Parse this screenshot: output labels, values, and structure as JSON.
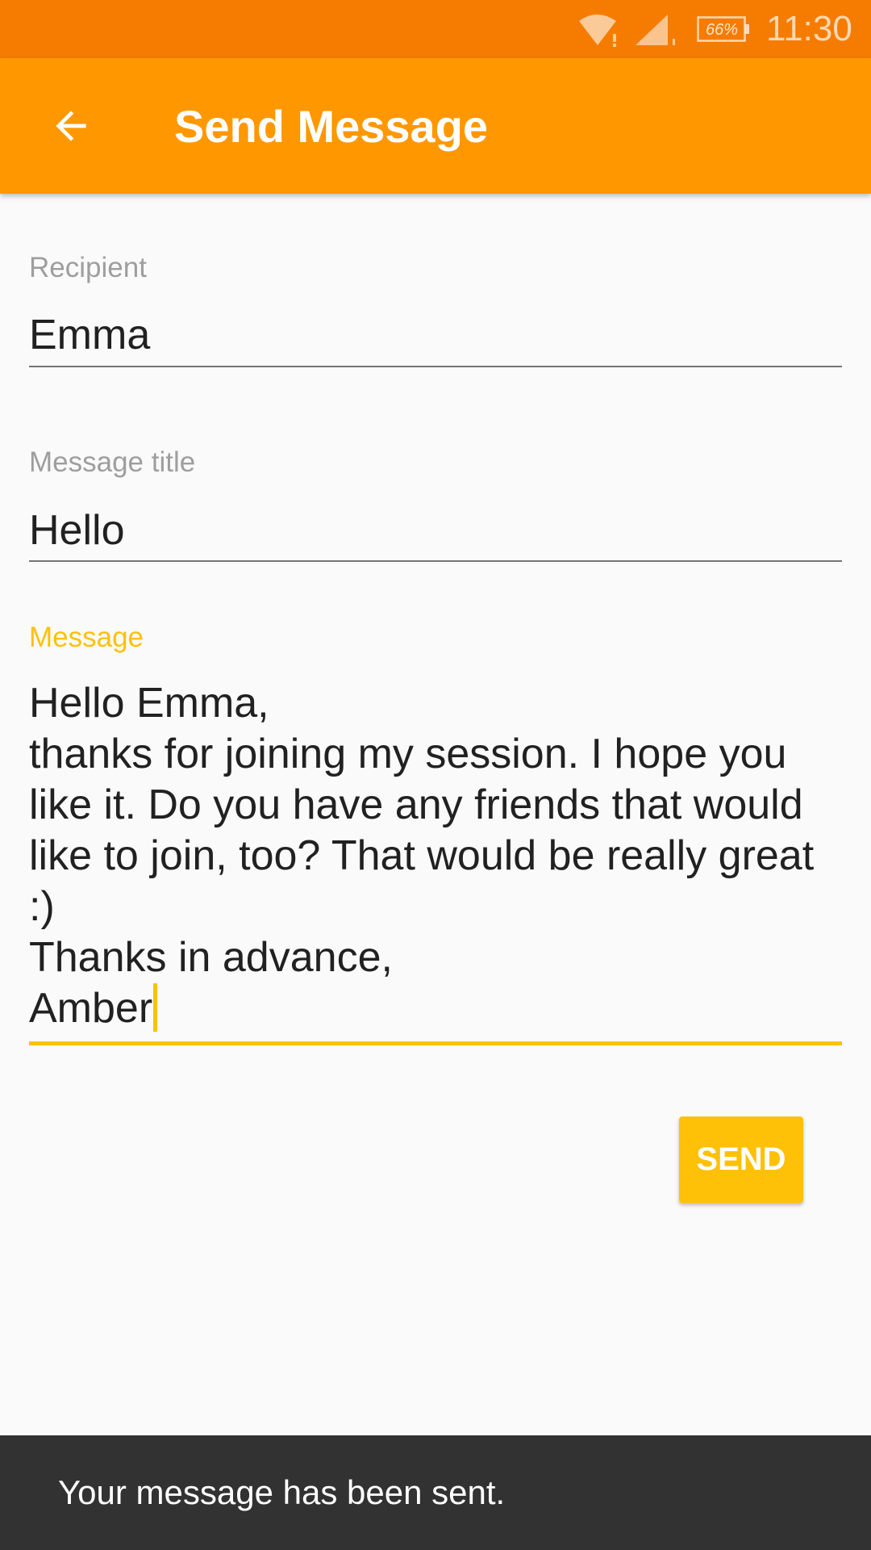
{
  "status_bar": {
    "battery": "66%",
    "time": "11:30",
    "icons": [
      "wifi-icon",
      "cell-signal-icon",
      "battery-icon"
    ]
  },
  "app_bar": {
    "back_icon": "arrow-back-icon",
    "title": "Send Message"
  },
  "form": {
    "recipient": {
      "label": "Recipient",
      "value": "Emma"
    },
    "title": {
      "label": "Message title",
      "value": "Hello"
    },
    "message": {
      "label": "Message",
      "value": "Hello Emma,\nthanks for joining my session. I hope you like it. Do you have any friends that would like to join, too? That would be really great :)\nThanks in advance,\nAmber"
    }
  },
  "send_label": "SEND",
  "snackbar": {
    "text": "Your message has been sent."
  },
  "colors": {
    "status_bar": "#f57c00",
    "app_bar": "#ff9800",
    "accent": "#ffc107",
    "snackbar": "#323232"
  }
}
